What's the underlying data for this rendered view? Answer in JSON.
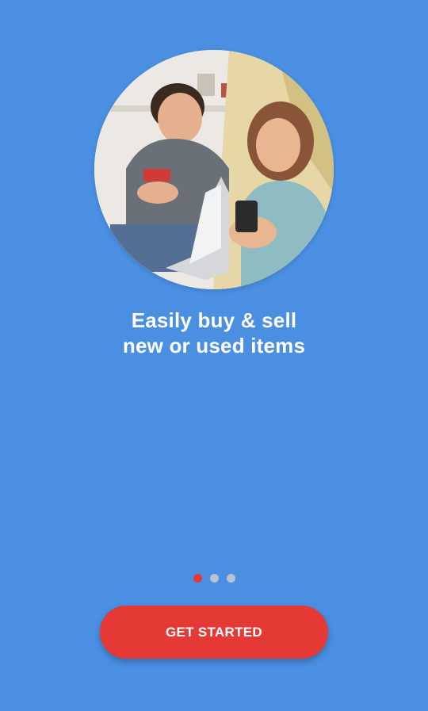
{
  "onboarding": {
    "headline_line1": "Easily buy & sell",
    "headline_line2": "new or used items",
    "cta_label": "GET STARTED",
    "pager": {
      "total": 3,
      "active_index": 0
    },
    "hero_image": "people-shopping-illustration"
  },
  "colors": {
    "background": "#4a8fe2",
    "accent": "#e53935",
    "dot_inactive": "#b8c3d2"
  }
}
